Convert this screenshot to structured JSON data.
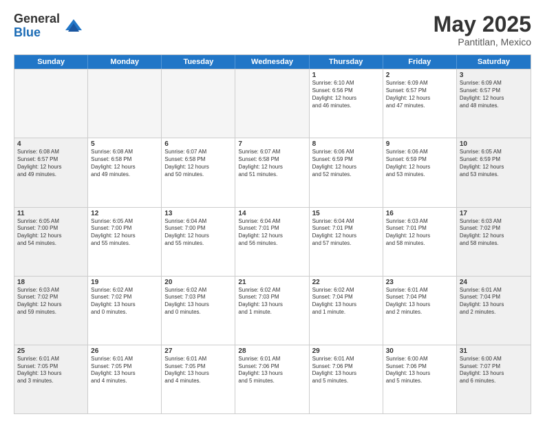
{
  "header": {
    "logo_general": "General",
    "logo_blue": "Blue",
    "month": "May 2025",
    "location": "Pantitlan, Mexico"
  },
  "days_of_week": [
    "Sunday",
    "Monday",
    "Tuesday",
    "Wednesday",
    "Thursday",
    "Friday",
    "Saturday"
  ],
  "weeks": [
    [
      {
        "day": "",
        "text": "",
        "shaded": true
      },
      {
        "day": "",
        "text": "",
        "shaded": true
      },
      {
        "day": "",
        "text": "",
        "shaded": true
      },
      {
        "day": "",
        "text": "",
        "shaded": true
      },
      {
        "day": "1",
        "text": "Sunrise: 6:10 AM\nSunset: 6:56 PM\nDaylight: 12 hours\nand 46 minutes."
      },
      {
        "day": "2",
        "text": "Sunrise: 6:09 AM\nSunset: 6:57 PM\nDaylight: 12 hours\nand 47 minutes."
      },
      {
        "day": "3",
        "text": "Sunrise: 6:09 AM\nSunset: 6:57 PM\nDaylight: 12 hours\nand 48 minutes."
      }
    ],
    [
      {
        "day": "4",
        "text": "Sunrise: 6:08 AM\nSunset: 6:57 PM\nDaylight: 12 hours\nand 49 minutes."
      },
      {
        "day": "5",
        "text": "Sunrise: 6:08 AM\nSunset: 6:58 PM\nDaylight: 12 hours\nand 49 minutes."
      },
      {
        "day": "6",
        "text": "Sunrise: 6:07 AM\nSunset: 6:58 PM\nDaylight: 12 hours\nand 50 minutes."
      },
      {
        "day": "7",
        "text": "Sunrise: 6:07 AM\nSunset: 6:58 PM\nDaylight: 12 hours\nand 51 minutes."
      },
      {
        "day": "8",
        "text": "Sunrise: 6:06 AM\nSunset: 6:59 PM\nDaylight: 12 hours\nand 52 minutes."
      },
      {
        "day": "9",
        "text": "Sunrise: 6:06 AM\nSunset: 6:59 PM\nDaylight: 12 hours\nand 53 minutes."
      },
      {
        "day": "10",
        "text": "Sunrise: 6:05 AM\nSunset: 6:59 PM\nDaylight: 12 hours\nand 53 minutes."
      }
    ],
    [
      {
        "day": "11",
        "text": "Sunrise: 6:05 AM\nSunset: 7:00 PM\nDaylight: 12 hours\nand 54 minutes."
      },
      {
        "day": "12",
        "text": "Sunrise: 6:05 AM\nSunset: 7:00 PM\nDaylight: 12 hours\nand 55 minutes."
      },
      {
        "day": "13",
        "text": "Sunrise: 6:04 AM\nSunset: 7:00 PM\nDaylight: 12 hours\nand 55 minutes."
      },
      {
        "day": "14",
        "text": "Sunrise: 6:04 AM\nSunset: 7:01 PM\nDaylight: 12 hours\nand 56 minutes."
      },
      {
        "day": "15",
        "text": "Sunrise: 6:04 AM\nSunset: 7:01 PM\nDaylight: 12 hours\nand 57 minutes."
      },
      {
        "day": "16",
        "text": "Sunrise: 6:03 AM\nSunset: 7:01 PM\nDaylight: 12 hours\nand 58 minutes."
      },
      {
        "day": "17",
        "text": "Sunrise: 6:03 AM\nSunset: 7:02 PM\nDaylight: 12 hours\nand 58 minutes."
      }
    ],
    [
      {
        "day": "18",
        "text": "Sunrise: 6:03 AM\nSunset: 7:02 PM\nDaylight: 12 hours\nand 59 minutes."
      },
      {
        "day": "19",
        "text": "Sunrise: 6:02 AM\nSunset: 7:02 PM\nDaylight: 13 hours\nand 0 minutes."
      },
      {
        "day": "20",
        "text": "Sunrise: 6:02 AM\nSunset: 7:03 PM\nDaylight: 13 hours\nand 0 minutes."
      },
      {
        "day": "21",
        "text": "Sunrise: 6:02 AM\nSunset: 7:03 PM\nDaylight: 13 hours\nand 1 minute."
      },
      {
        "day": "22",
        "text": "Sunrise: 6:02 AM\nSunset: 7:04 PM\nDaylight: 13 hours\nand 1 minute."
      },
      {
        "day": "23",
        "text": "Sunrise: 6:01 AM\nSunset: 7:04 PM\nDaylight: 13 hours\nand 2 minutes."
      },
      {
        "day": "24",
        "text": "Sunrise: 6:01 AM\nSunset: 7:04 PM\nDaylight: 13 hours\nand 2 minutes."
      }
    ],
    [
      {
        "day": "25",
        "text": "Sunrise: 6:01 AM\nSunset: 7:05 PM\nDaylight: 13 hours\nand 3 minutes."
      },
      {
        "day": "26",
        "text": "Sunrise: 6:01 AM\nSunset: 7:05 PM\nDaylight: 13 hours\nand 4 minutes."
      },
      {
        "day": "27",
        "text": "Sunrise: 6:01 AM\nSunset: 7:05 PM\nDaylight: 13 hours\nand 4 minutes."
      },
      {
        "day": "28",
        "text": "Sunrise: 6:01 AM\nSunset: 7:06 PM\nDaylight: 13 hours\nand 5 minutes."
      },
      {
        "day": "29",
        "text": "Sunrise: 6:01 AM\nSunset: 7:06 PM\nDaylight: 13 hours\nand 5 minutes."
      },
      {
        "day": "30",
        "text": "Sunrise: 6:00 AM\nSunset: 7:06 PM\nDaylight: 13 hours\nand 5 minutes."
      },
      {
        "day": "31",
        "text": "Sunrise: 6:00 AM\nSunset: 7:07 PM\nDaylight: 13 hours\nand 6 minutes."
      }
    ]
  ]
}
